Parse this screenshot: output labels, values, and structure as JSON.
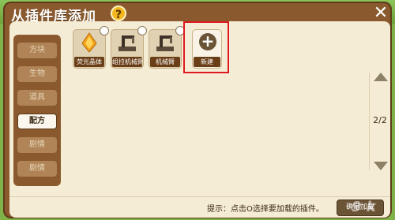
{
  "dialog": {
    "title": "从插件库添加",
    "help_label": "?",
    "close_label": "✕"
  },
  "sidebar": {
    "items": [
      {
        "label": "方块",
        "active": false
      },
      {
        "label": "生物",
        "active": false
      },
      {
        "label": "道具",
        "active": false
      },
      {
        "label": "配方",
        "active": true
      },
      {
        "label": "剧情",
        "active": false
      },
      {
        "label": "剧情",
        "active": false
      }
    ]
  },
  "cards": [
    {
      "label": "荧光晶体",
      "icon": "crystal-icon"
    },
    {
      "label": "组拉机械臂",
      "icon": "arm-icon"
    },
    {
      "label": "机械臂",
      "icon": "arm-icon"
    }
  ],
  "new_card": {
    "label": "新建",
    "icon": "plus-icon"
  },
  "pagination": {
    "label": "2/2"
  },
  "footer": {
    "hint": "提示：点击O选择要加载的插件。",
    "load_button": "确定加载"
  },
  "watermark": "9 k"
}
